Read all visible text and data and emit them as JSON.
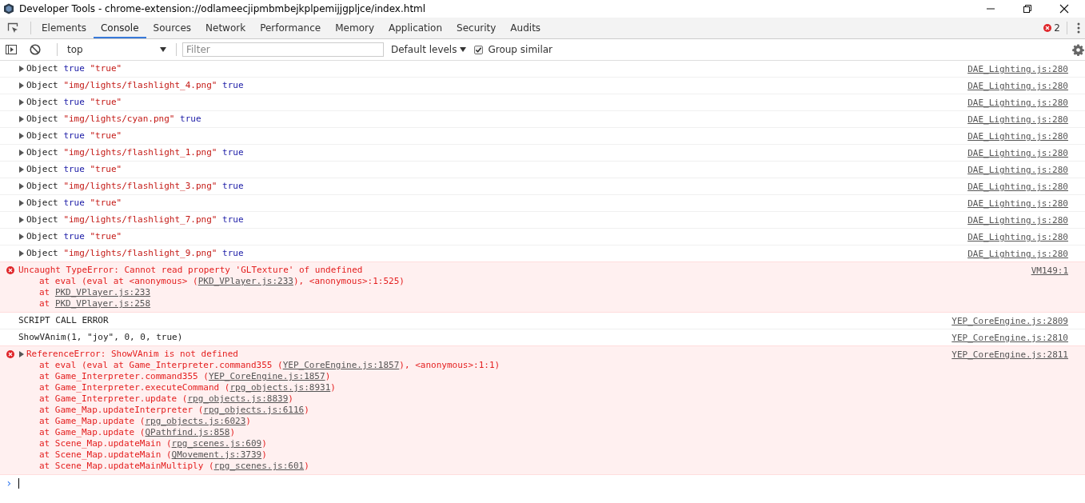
{
  "window": {
    "title": "Developer Tools - chrome-extension://odlameecjipmbmbejkplpemijjgpljce/index.html"
  },
  "tabs": [
    {
      "label": "Elements",
      "selected": false
    },
    {
      "label": "Console",
      "selected": true
    },
    {
      "label": "Sources",
      "selected": false
    },
    {
      "label": "Network",
      "selected": false
    },
    {
      "label": "Performance",
      "selected": false
    },
    {
      "label": "Memory",
      "selected": false
    },
    {
      "label": "Application",
      "selected": false
    },
    {
      "label": "Security",
      "selected": false
    },
    {
      "label": "Audits",
      "selected": false
    }
  ],
  "error_count": "2",
  "toolbar": {
    "context": "top",
    "filter_placeholder": "Filter",
    "levels": "Default levels",
    "group_similar": {
      "label": "Group similar",
      "checked": true
    }
  },
  "messages": [
    {
      "kind": "log",
      "expandable": true,
      "tokens": [
        {
          "kind": "plain",
          "text": "Object"
        },
        {
          "kind": "bool",
          "text": "true"
        },
        {
          "kind": "string",
          "text": "\"true\""
        }
      ],
      "source": "DAE_Lighting.js:280"
    },
    {
      "kind": "log",
      "expandable": true,
      "tokens": [
        {
          "kind": "plain",
          "text": "Object"
        },
        {
          "kind": "string",
          "text": "\"img/lights/flashlight_4.png\""
        },
        {
          "kind": "bool",
          "text": "true"
        }
      ],
      "source": "DAE_Lighting.js:280"
    },
    {
      "kind": "log",
      "expandable": true,
      "tokens": [
        {
          "kind": "plain",
          "text": "Object"
        },
        {
          "kind": "bool",
          "text": "true"
        },
        {
          "kind": "string",
          "text": "\"true\""
        }
      ],
      "source": "DAE_Lighting.js:280"
    },
    {
      "kind": "log",
      "expandable": true,
      "tokens": [
        {
          "kind": "plain",
          "text": "Object"
        },
        {
          "kind": "string",
          "text": "\"img/lights/cyan.png\""
        },
        {
          "kind": "bool",
          "text": "true"
        }
      ],
      "source": "DAE_Lighting.js:280"
    },
    {
      "kind": "log",
      "expandable": true,
      "tokens": [
        {
          "kind": "plain",
          "text": "Object"
        },
        {
          "kind": "bool",
          "text": "true"
        },
        {
          "kind": "string",
          "text": "\"true\""
        }
      ],
      "source": "DAE_Lighting.js:280"
    },
    {
      "kind": "log",
      "expandable": true,
      "tokens": [
        {
          "kind": "plain",
          "text": "Object"
        },
        {
          "kind": "string",
          "text": "\"img/lights/flashlight_1.png\""
        },
        {
          "kind": "bool",
          "text": "true"
        }
      ],
      "source": "DAE_Lighting.js:280"
    },
    {
      "kind": "log",
      "expandable": true,
      "tokens": [
        {
          "kind": "plain",
          "text": "Object"
        },
        {
          "kind": "bool",
          "text": "true"
        },
        {
          "kind": "string",
          "text": "\"true\""
        }
      ],
      "source": "DAE_Lighting.js:280"
    },
    {
      "kind": "log",
      "expandable": true,
      "tokens": [
        {
          "kind": "plain",
          "text": "Object"
        },
        {
          "kind": "string",
          "text": "\"img/lights/flashlight_3.png\""
        },
        {
          "kind": "bool",
          "text": "true"
        }
      ],
      "source": "DAE_Lighting.js:280"
    },
    {
      "kind": "log",
      "expandable": true,
      "tokens": [
        {
          "kind": "plain",
          "text": "Object"
        },
        {
          "kind": "bool",
          "text": "true"
        },
        {
          "kind": "string",
          "text": "\"true\""
        }
      ],
      "source": "DAE_Lighting.js:280"
    },
    {
      "kind": "log",
      "expandable": true,
      "tokens": [
        {
          "kind": "plain",
          "text": "Object"
        },
        {
          "kind": "string",
          "text": "\"img/lights/flashlight_7.png\""
        },
        {
          "kind": "bool",
          "text": "true"
        }
      ],
      "source": "DAE_Lighting.js:280"
    },
    {
      "kind": "log",
      "expandable": true,
      "tokens": [
        {
          "kind": "plain",
          "text": "Object"
        },
        {
          "kind": "bool",
          "text": "true"
        },
        {
          "kind": "string",
          "text": "\"true\""
        }
      ],
      "source": "DAE_Lighting.js:280"
    },
    {
      "kind": "log",
      "expandable": true,
      "tokens": [
        {
          "kind": "plain",
          "text": "Object"
        },
        {
          "kind": "string",
          "text": "\"img/lights/flashlight_9.png\""
        },
        {
          "kind": "bool",
          "text": "true"
        }
      ],
      "source": "DAE_Lighting.js:280"
    },
    {
      "kind": "error",
      "expandable": false,
      "text": "Uncaught TypeError: Cannot read property 'GLTexture' of undefined",
      "stack": [
        {
          "before": "at eval (eval at <anonymous> (",
          "link": "PKD_VPlayer.js:233",
          "after": "), <anonymous>:1:525)"
        },
        {
          "before": "at ",
          "link": "PKD_VPlayer.js:233"
        },
        {
          "before": "at ",
          "link": "PKD_VPlayer.js:258"
        }
      ],
      "source": "VM149:1"
    },
    {
      "kind": "text",
      "text": "SCRIPT CALL ERROR",
      "source": "YEP_CoreEngine.js:2809"
    },
    {
      "kind": "text",
      "text": "ShowVAnim(1, \"joy\", 0, 0, true)",
      "source": "YEP_CoreEngine.js:2810"
    },
    {
      "kind": "error",
      "expandable": true,
      "text": "ReferenceError: ShowVAnim is not defined",
      "stack": [
        {
          "before": "at eval (eval at Game_Interpreter.command355 (",
          "link": "YEP_CoreEngine.js:1857",
          "after": "), <anonymous>:1:1)"
        },
        {
          "before": "at Game_Interpreter.command355 (",
          "link": "YEP_CoreEngine.js:1857",
          "after": ")"
        },
        {
          "before": "at Game_Interpreter.executeCommand (",
          "link": "rpg_objects.js:8931",
          "after": ")"
        },
        {
          "before": "at Game_Interpreter.update (",
          "link": "rpg_objects.js:8839",
          "after": ")"
        },
        {
          "before": "at Game_Map.updateInterpreter (",
          "link": "rpg_objects.js:6116",
          "after": ")"
        },
        {
          "before": "at Game_Map.update (",
          "link": "rpg_objects.js:6023",
          "after": ")"
        },
        {
          "before": "at Game_Map.update (",
          "link": "QPathfind.js:858",
          "after": ")"
        },
        {
          "before": "at Scene_Map.updateMain (",
          "link": "rpg_scenes.js:609",
          "after": ")"
        },
        {
          "before": "at Scene_Map.updateMain (",
          "link": "QMovement.js:3739",
          "after": ")"
        },
        {
          "before": "at Scene_Map.updateMainMultiply (",
          "link": "rpg_scenes.js:601",
          "after": ")"
        }
      ],
      "source": "YEP_CoreEngine.js:2811"
    }
  ],
  "prompt": {
    "symbol": "›"
  }
}
